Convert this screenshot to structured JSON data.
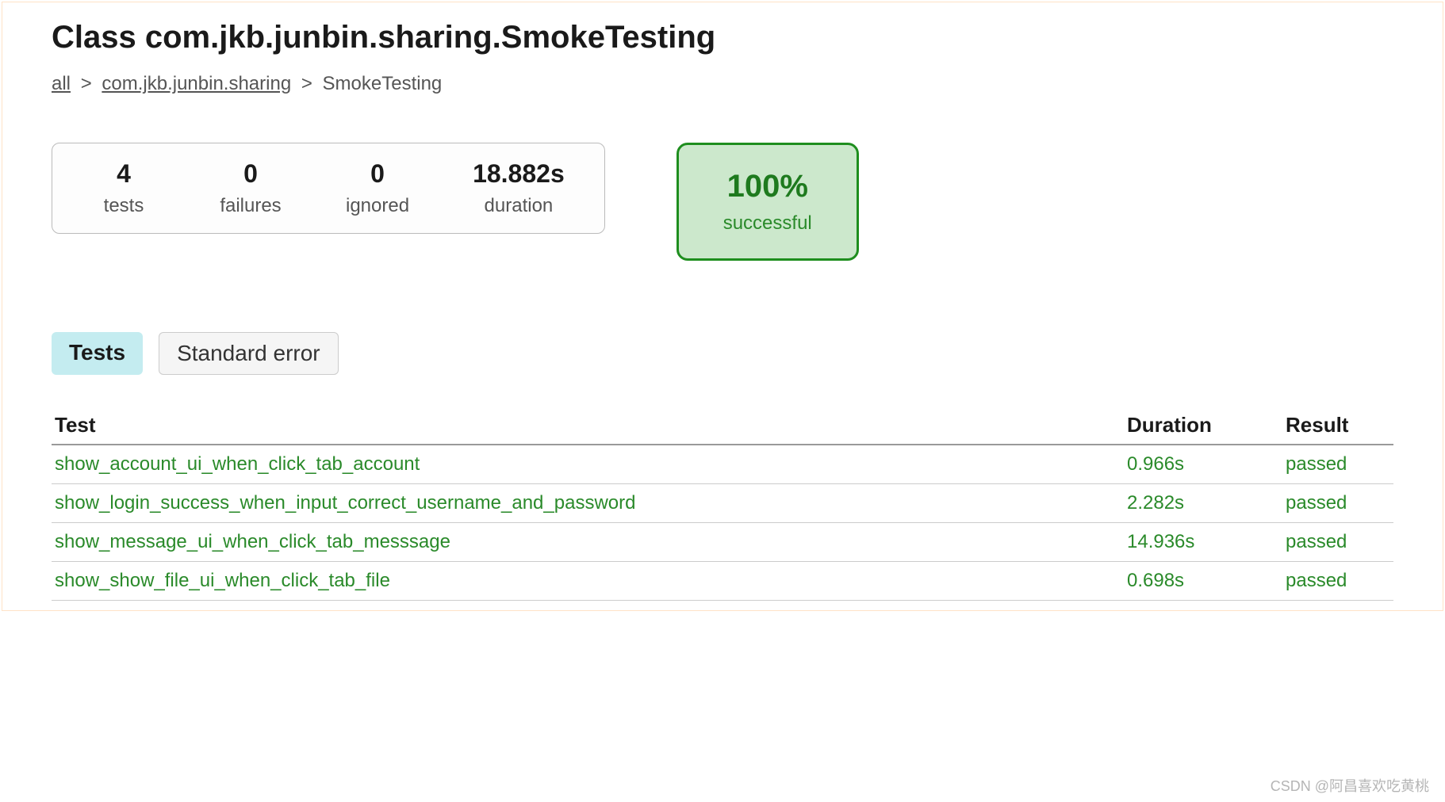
{
  "title": "Class com.jkb.junbin.sharing.SmokeTesting",
  "breadcrumb": {
    "all": "all",
    "package": "com.jkb.junbin.sharing",
    "current": "SmokeTesting"
  },
  "metrics": {
    "tests": {
      "value": "4",
      "label": "tests"
    },
    "failures": {
      "value": "0",
      "label": "failures"
    },
    "ignored": {
      "value": "0",
      "label": "ignored"
    },
    "duration": {
      "value": "18.882s",
      "label": "duration"
    }
  },
  "success": {
    "value": "100%",
    "label": "successful"
  },
  "tabs": {
    "tests": "Tests",
    "stderr": "Standard error"
  },
  "table": {
    "headers": {
      "test": "Test",
      "duration": "Duration",
      "result": "Result"
    },
    "rows": [
      {
        "name": "show_account_ui_when_click_tab_account",
        "duration": "0.966s",
        "result": "passed"
      },
      {
        "name": "show_login_success_when_input_correct_username_and_password",
        "duration": "2.282s",
        "result": "passed"
      },
      {
        "name": "show_message_ui_when_click_tab_messsage",
        "duration": "14.936s",
        "result": "passed"
      },
      {
        "name": "show_show_file_ui_when_click_tab_file",
        "duration": "0.698s",
        "result": "passed"
      }
    ]
  },
  "watermark": "CSDN @阿昌喜欢吃黄桃"
}
